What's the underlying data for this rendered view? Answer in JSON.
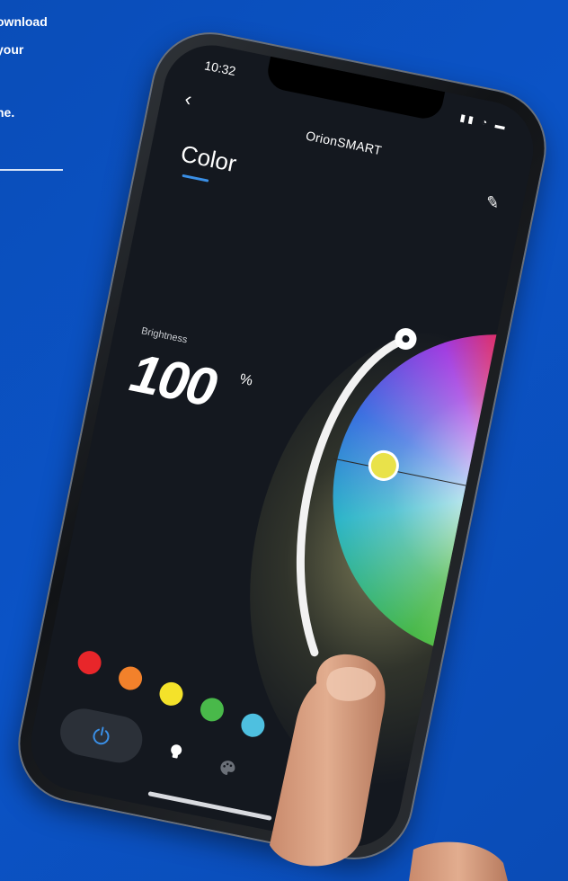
{
  "promo": {
    "lines": [
      "ownload",
      "your",
      "",
      "ne."
    ]
  },
  "status_bar": {
    "time": "10:32"
  },
  "app": {
    "title": "OrionSMART",
    "tab": "Color",
    "brightness_label": "Brightness",
    "brightness_value": "100",
    "brightness_unit": "%"
  },
  "colors": {
    "accent": "#3a8fe6",
    "background": "#0b53c6",
    "screen": "#14181f"
  },
  "swatches": [
    {
      "name": "red",
      "color": "#e8262a"
    },
    {
      "name": "orange",
      "color": "#f2812b"
    },
    {
      "name": "yellow",
      "color": "#f4e22a"
    },
    {
      "name": "green",
      "color": "#49b94a"
    },
    {
      "name": "cyan",
      "color": "#4ec0e0"
    }
  ],
  "icons": {
    "back": "back-chevron-icon",
    "edit": "edit-pencil-icon",
    "power": "power-icon",
    "bulb": "bulb-icon",
    "palette": "palette-icon"
  }
}
